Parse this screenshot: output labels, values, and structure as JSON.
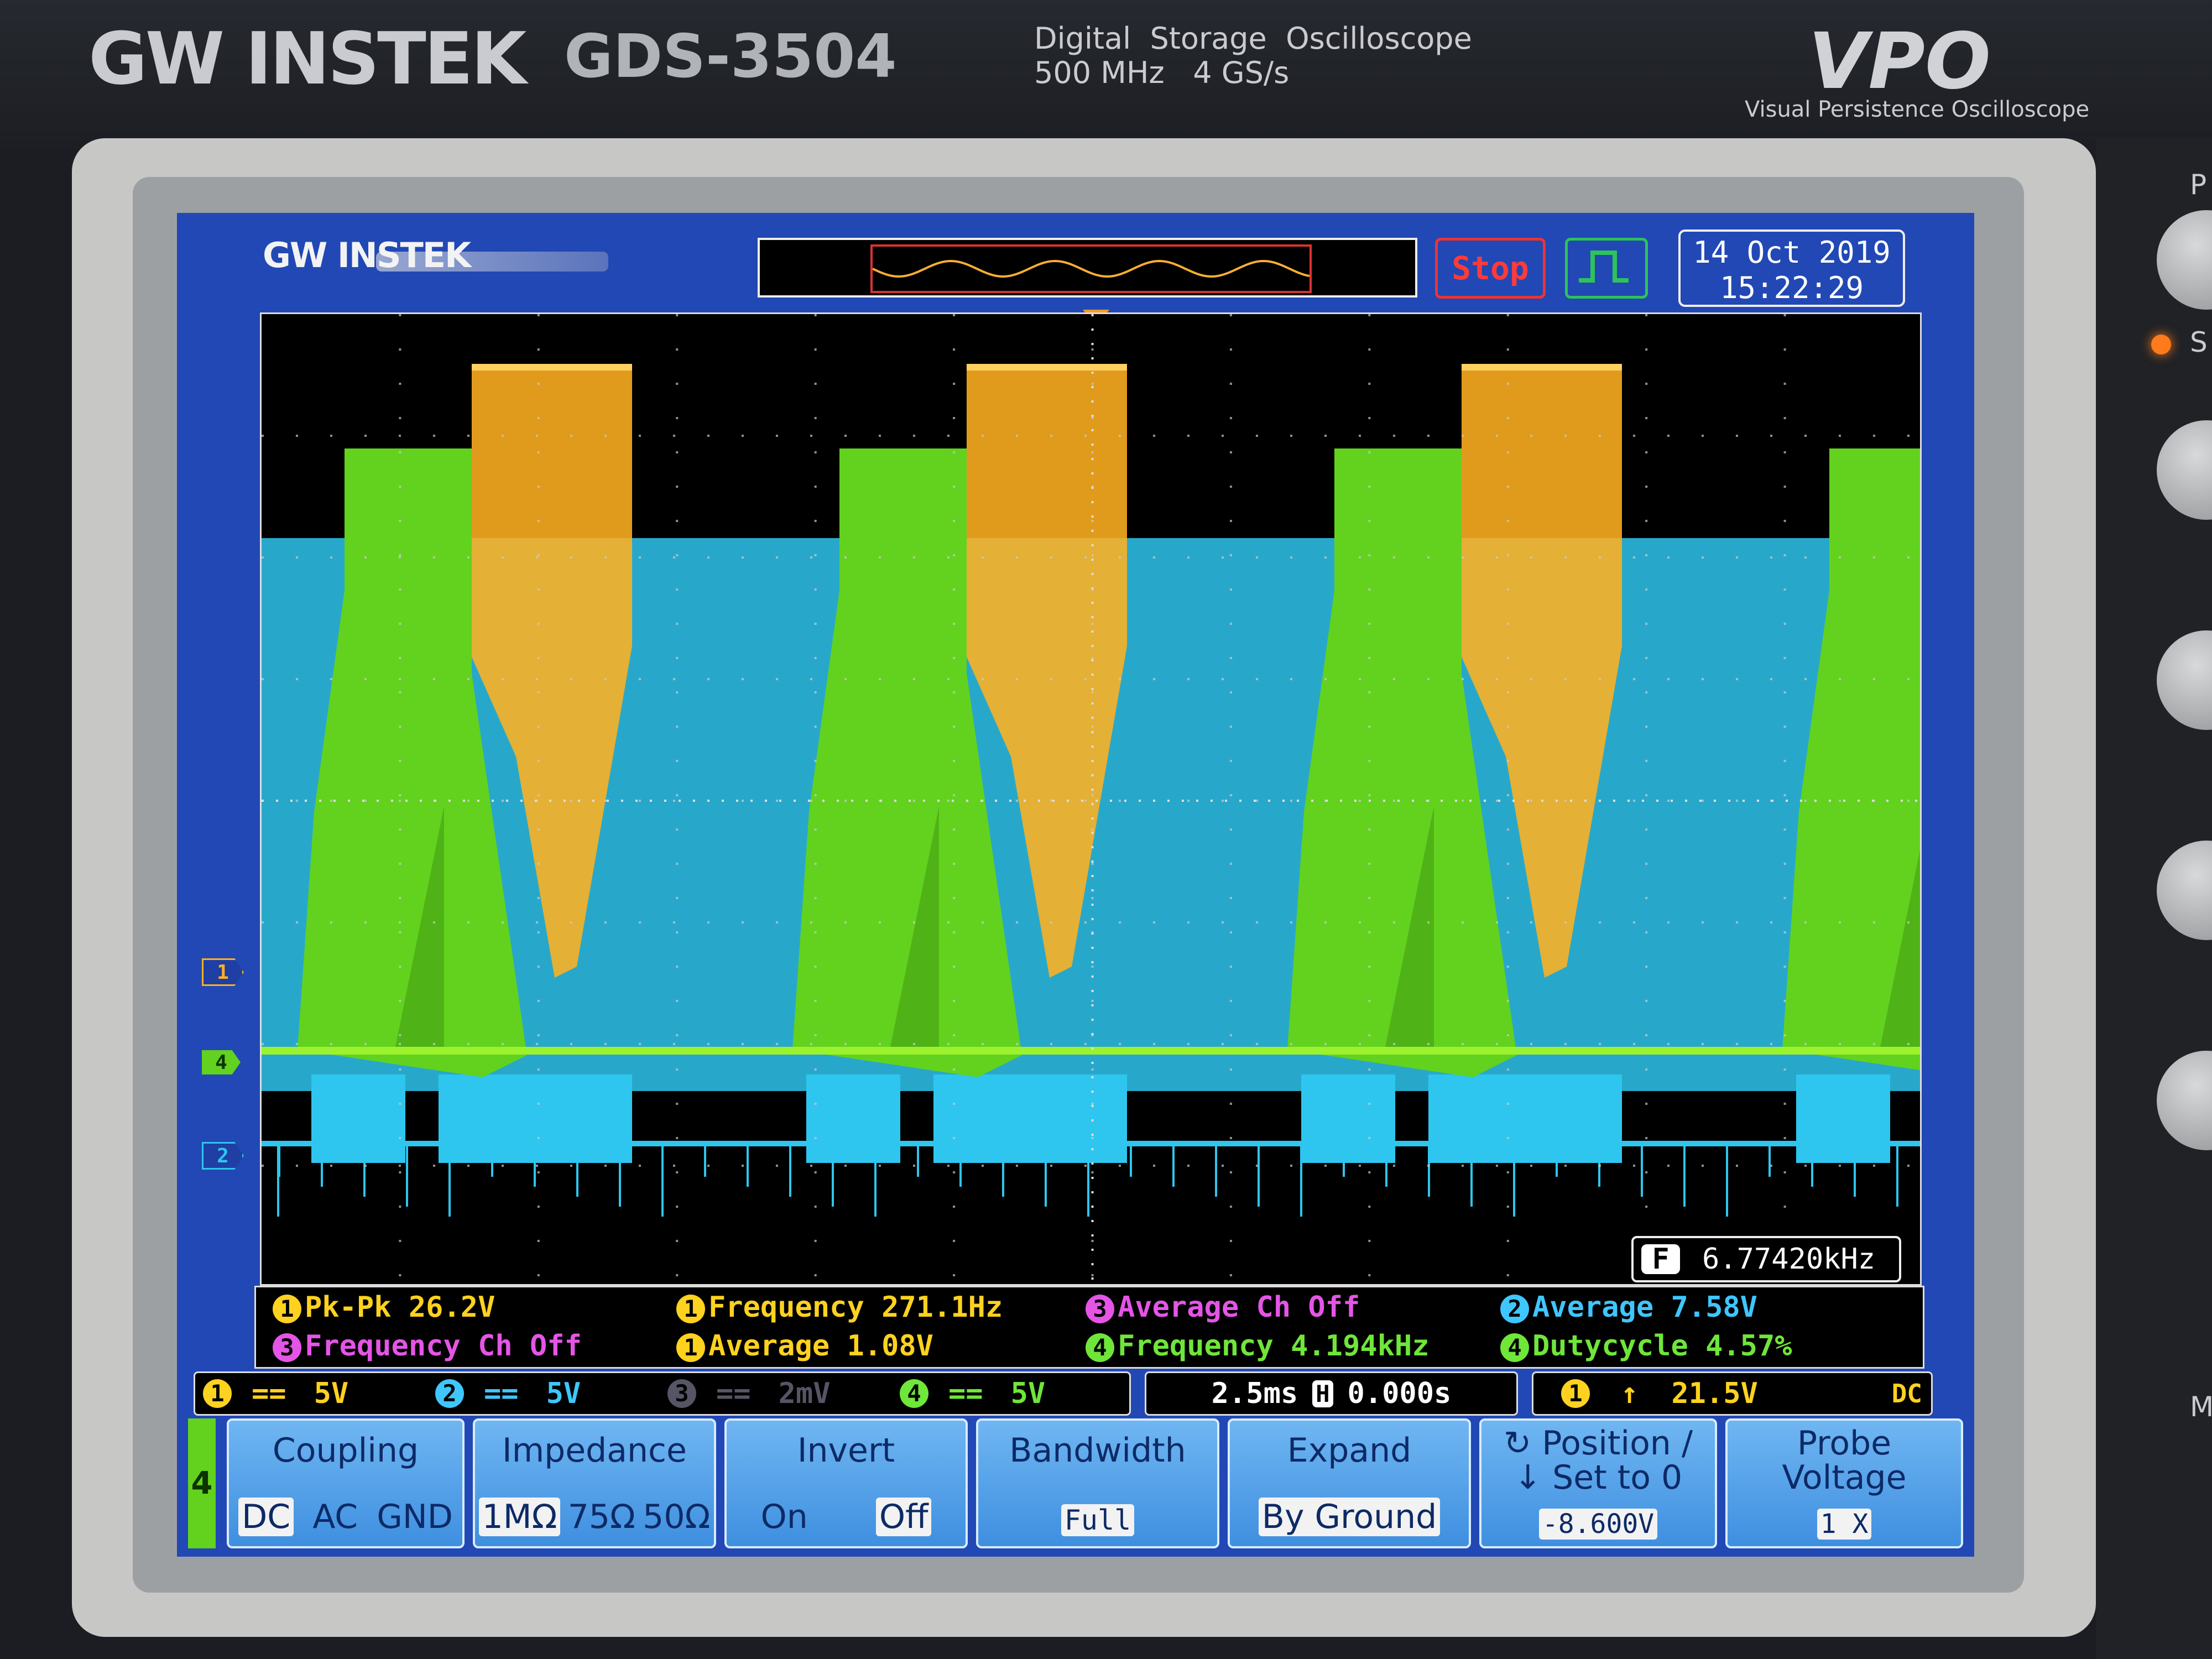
{
  "device": {
    "brand": "GW INSTEK",
    "model": "GDS-3504",
    "description_line1": "Digital  Storage  Oscilloscope",
    "description_line2": "500 MHz   4 GS/s",
    "vpo_logo": "VPO",
    "vpo_caption": "Visual Persistence Oscilloscope",
    "side_letters": [
      "P",
      "S",
      "M"
    ]
  },
  "screen": {
    "logo": "GW INSTEK",
    "run_state": "Stop",
    "trigger_icon": "pulse-trigger-icon",
    "date": "14 Oct 2019",
    "time": "15:22:29",
    "channel_markers": [
      "1",
      "4",
      "2"
    ],
    "frequency_counter": {
      "badge": "F",
      "value": "6.77420kHz"
    }
  },
  "measurements": [
    {
      "channel": "1",
      "text": "Pk-Pk 26.2V",
      "color": "#ffd21f"
    },
    {
      "channel": "1",
      "text": "Frequency 271.1Hz",
      "color": "#ffd21f"
    },
    {
      "channel": "3",
      "text": "Average Ch Off",
      "color": "#e455e6"
    },
    {
      "channel": "2",
      "text": "Average 7.58V",
      "color": "#3fc6ff"
    },
    {
      "channel": "3",
      "text": "Frequency Ch Off",
      "color": "#e455e6"
    },
    {
      "channel": "1",
      "text": "Average 1.08V",
      "color": "#ffd21f"
    },
    {
      "channel": "4",
      "text": "Frequency 4.194kHz",
      "color": "#6fe63a"
    },
    {
      "channel": "4",
      "text": "Dutycycle 4.57%",
      "color": "#6fe63a"
    }
  ],
  "status": {
    "channels": [
      {
        "num": "1",
        "coupling": "==",
        "scale": "5V",
        "color": "#ffd21f"
      },
      {
        "num": "2",
        "coupling": "==",
        "scale": "5V",
        "color": "#3fc6ff"
      },
      {
        "num": "3",
        "coupling": "==",
        "scale": "2mV",
        "color": "#555566"
      },
      {
        "num": "4",
        "coupling": "==",
        "scale": "5V",
        "color": "#6fe63a"
      }
    ],
    "timebase": "2.5ms",
    "horizontal_badge": "H",
    "horizontal_position": "0.000s",
    "trigger_channel": "1",
    "trigger_slope": "↑",
    "trigger_level": "21.5V",
    "trigger_coupling": "DC"
  },
  "softkeys": {
    "channel_tab": "4",
    "coupling": {
      "title": "Coupling",
      "options": [
        "DC",
        "AC",
        "GND"
      ],
      "selected": "DC"
    },
    "impedance": {
      "title": "Impedance",
      "options": [
        "1MΩ",
        "75Ω",
        "50Ω"
      ],
      "selected": "1MΩ"
    },
    "invert": {
      "title": "Invert",
      "options": [
        "On",
        "Off"
      ],
      "selected": "Off"
    },
    "bandwidth": {
      "title": "Bandwidth",
      "value": "Full"
    },
    "expand": {
      "title": "Expand",
      "value": "By Ground"
    },
    "position": {
      "title_line1": "↻ Position /",
      "title_line2": "↓ Set to 0",
      "value": "-8.600V"
    },
    "probe": {
      "title_line1": "Probe",
      "title_line2": "Voltage",
      "value": "1 X"
    }
  },
  "colors": {
    "ch1": "#ffb020",
    "ch2": "#2ec6ee",
    "ch4": "#62d21e",
    "screen_bg": "#2148b5"
  }
}
